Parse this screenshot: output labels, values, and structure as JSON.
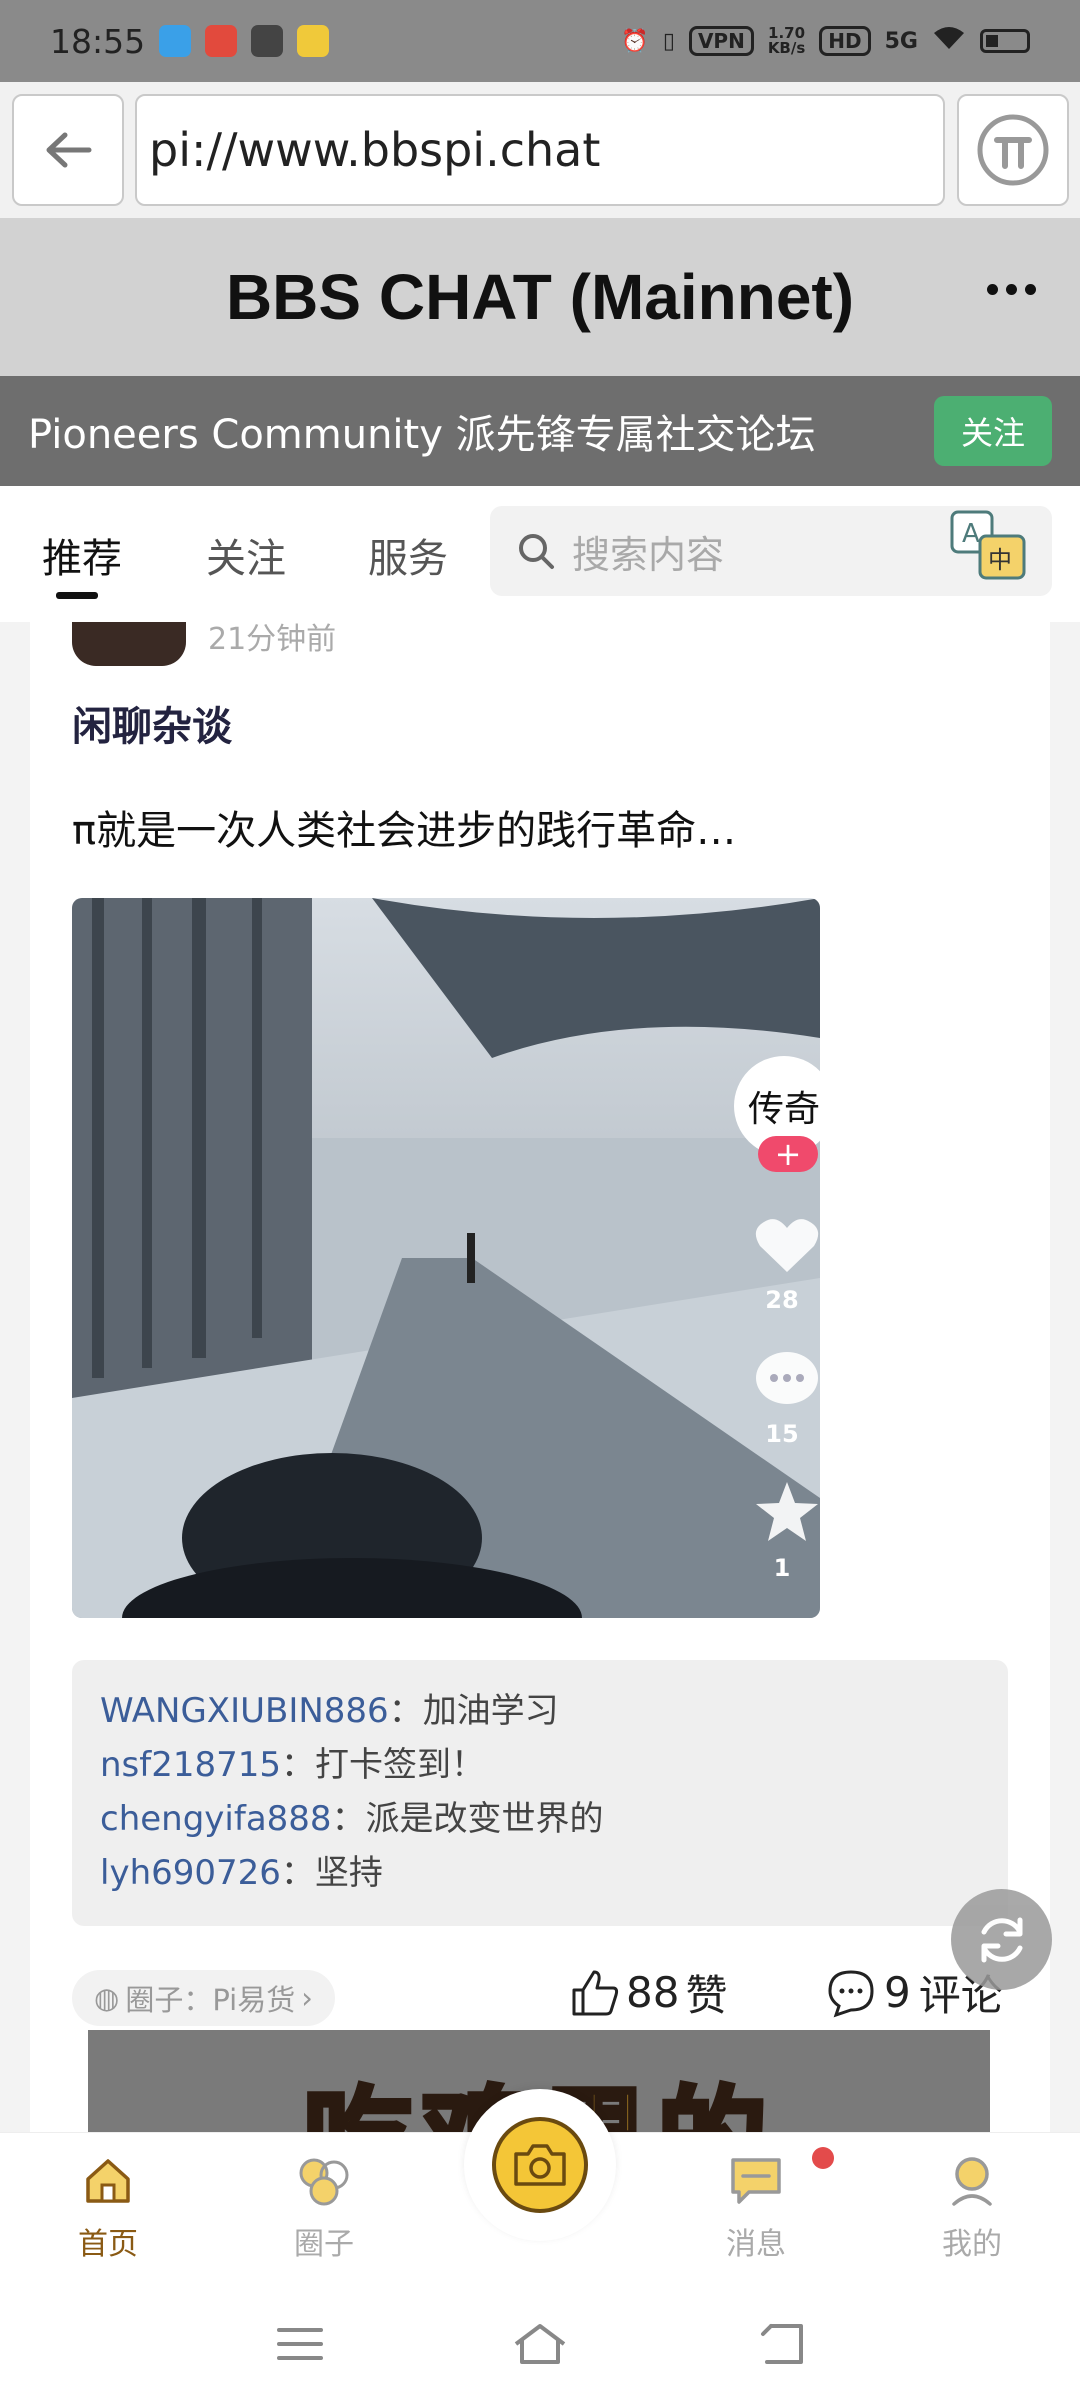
{
  "status_bar": {
    "time": "18:55",
    "vpn": "VPN",
    "speed_value": "1.70",
    "speed_unit": "KB/s",
    "hd": "HD",
    "network": "5G"
  },
  "browser": {
    "url": "pi://www.bbspi.chat"
  },
  "header": {
    "title": "BBS CHAT (Mainnet)"
  },
  "community": {
    "title": "Pioneers Community 派先锋专属社交论坛",
    "follow_label": "关注"
  },
  "tabs": [
    {
      "label": "推荐"
    },
    {
      "label": "关注"
    },
    {
      "label": "服务"
    }
  ],
  "search": {
    "placeholder": "搜索内容"
  },
  "post": {
    "time": "21分钟前",
    "category": "闲聊杂谈",
    "text": "π就是一次人类社会进步的践行革命…",
    "video": {
      "author_glyph": "传奇",
      "likes": "28",
      "comments": "15",
      "favorites": "1"
    },
    "comments": [
      {
        "user": "WANGXIUBIN886",
        "text": "加油学习"
      },
      {
        "user": "nsf218715",
        "text": "打卡签到！"
      },
      {
        "user": "chengyifa888",
        "text": "派是改变世界的"
      },
      {
        "user": "lyh690726",
        "text": "坚持"
      }
    ],
    "circle_tag": "圈子：Pi易货",
    "like_count": "88",
    "like_label": "赞",
    "comment_count": "9",
    "comment_label": "评论"
  },
  "next_post": {
    "banner_text": "吃鸡果的"
  },
  "bottom_nav": [
    {
      "label": "首页",
      "icon": "home-icon"
    },
    {
      "label": "圈子",
      "icon": "circles-icon"
    },
    {
      "label": "消息",
      "icon": "message-icon"
    },
    {
      "label": "我的",
      "icon": "profile-icon"
    }
  ],
  "colors": {
    "accent_green": "#4caf72",
    "brand_gold": "#f4c637",
    "link_blue": "#3b5d99"
  }
}
